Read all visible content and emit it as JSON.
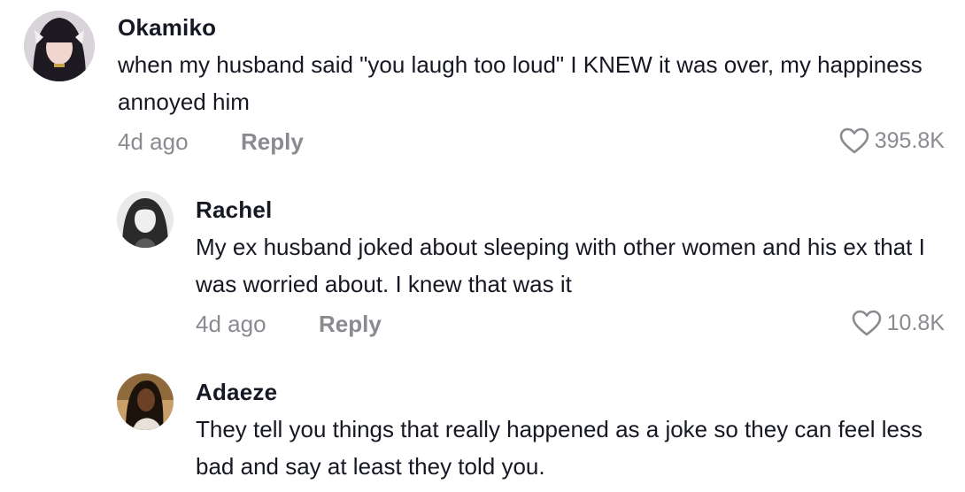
{
  "comments": [
    {
      "username": "Okamiko",
      "text": "when my husband said \"you laugh too loud\" I KNEW it was over, my happiness annoyed him",
      "time": "4d ago",
      "reply_label": "Reply",
      "likes": "395.8K"
    },
    {
      "username": "Rachel",
      "text": "My ex husband joked about sleeping with other women and his ex that I was worried about. I knew that was it",
      "time": "4d ago",
      "reply_label": "Reply",
      "likes": "10.8K"
    },
    {
      "username": "Adaeze",
      "text": "They tell you things that really happened as a joke so they can feel less bad and say at least they told you."
    }
  ],
  "icons": {
    "like": "heart-outline-icon"
  },
  "colors": {
    "text_primary": "#161823",
    "text_secondary": "#8a8b91",
    "background": "#ffffff"
  }
}
